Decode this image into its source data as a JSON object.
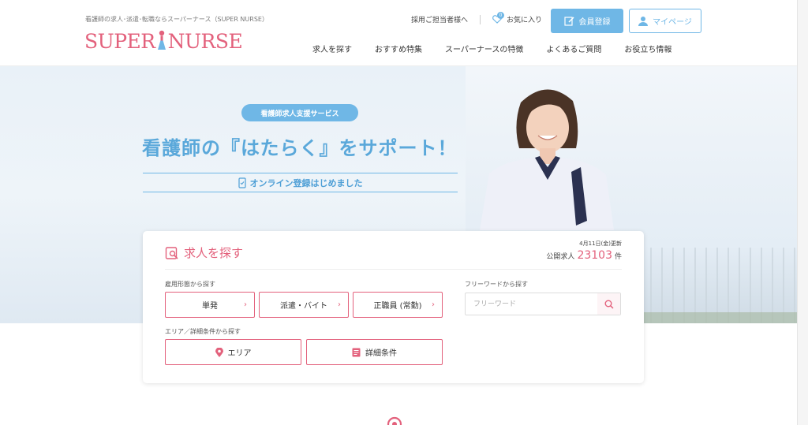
{
  "header": {
    "tagline": "看護師の求人･派遣･転職ならスーパーナース（SUPER NURSE）",
    "logo_left": "SUPER",
    "logo_right": "NURSE",
    "recruiter_link": "採用ご担当者様へ",
    "favorites_label": "お気に入り",
    "favorites_count": "0",
    "register_label": "会員登録",
    "mypage_label": "マイページ"
  },
  "nav": {
    "items": [
      "求人を探す",
      "おすすめ特集",
      "スーパーナースの特徴",
      "よくあるご質問",
      "お役立ち情報"
    ]
  },
  "hero": {
    "pill": "看護師求人支援サービス",
    "headline": "看護師の『はたらく』をサポート！",
    "online_emph": "オンライン登録",
    "online_rest": "はじめました"
  },
  "search": {
    "title": "求人を探す",
    "updated": "4月11日(金)更新",
    "count_label": "公開求人",
    "count": "23103",
    "count_unit": "件",
    "employment_label": "雇用形態から探す",
    "employment_buttons": [
      "単発",
      "派遣・バイト",
      "正職員 (常勤)"
    ],
    "freeword_label": "フリーワードから探す",
    "freeword_placeholder": "フリーワード",
    "area_label": "エリア／詳細条件から探す",
    "area_button": "エリア",
    "detail_button": "詳細条件"
  },
  "colors": {
    "brand_pink": "#e3617c",
    "accent_blue": "#6fb7e6"
  }
}
